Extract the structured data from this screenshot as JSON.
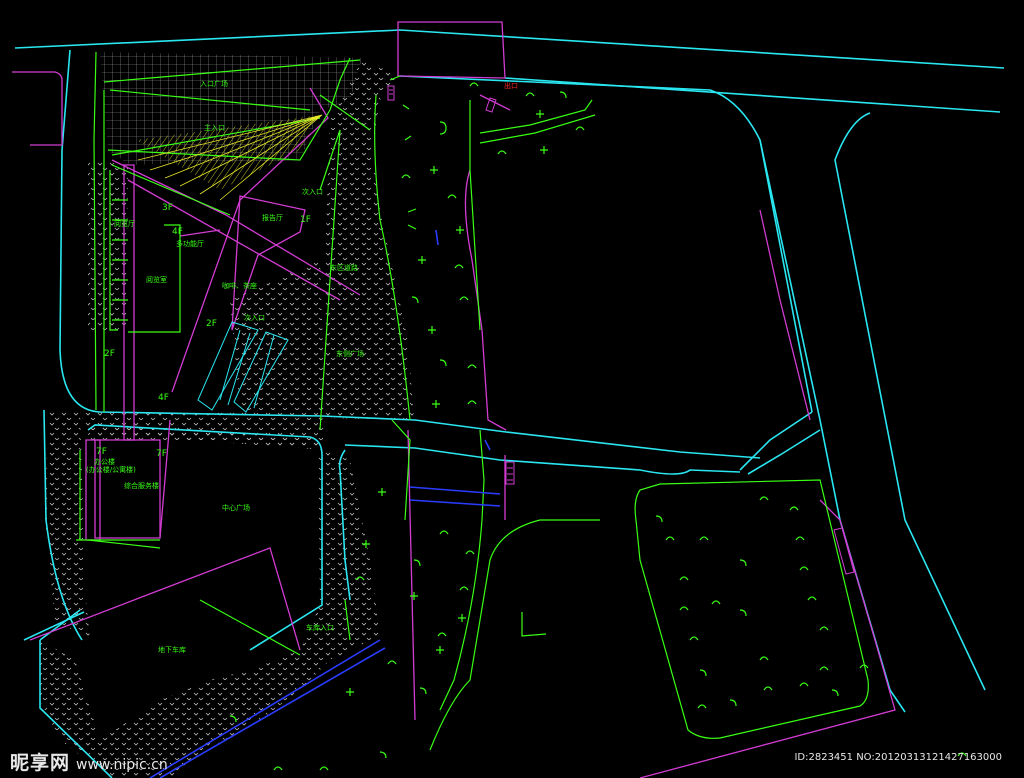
{
  "labels": {
    "square_top": "入口广场",
    "main_entrance": "主入口",
    "floor_3f": "3F",
    "floor_1f": "1F",
    "floor_4f_top": "4F",
    "floor_2f_mid": "2F",
    "floor_2f_left": "2F",
    "floor_4f_bottom": "4F",
    "floor_7f": "7F",
    "floor_7f_b": "7F",
    "hall_a": "阅览厅",
    "hall_b": "多功能厅",
    "hall_c": "报告厅",
    "office": "阅览室",
    "cafe": "咖啡、茶座",
    "entry_a": "次入口",
    "entry_b": "次入口",
    "parking_road": "东区道路",
    "east_square": "东侧广场",
    "tower_a": "办公楼",
    "tower_a_sub": "(办公楼/公寓楼)",
    "tower_b": "综合服务楼",
    "central_square": "中心广场",
    "car_entry": "车库入口",
    "underground": "地下车库",
    "gate_note": "出口"
  },
  "footer": {
    "watermark": "昵享网",
    "site": "www.nipic.cn",
    "image_id": "ID:2823451 NO:20120313121427163000"
  },
  "colors": {
    "road_cyan": "#29e6f0",
    "building_magenta": "#d23cd2",
    "green": "#39ff14",
    "yellow": "#e6e62a",
    "blue": "#2a3cff",
    "red": "#ff2a2a",
    "background": "#000000"
  }
}
